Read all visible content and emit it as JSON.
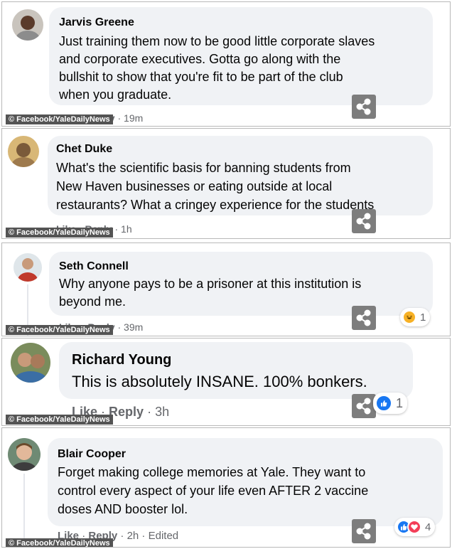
{
  "credit": "© Facebook/YaleDailyNews",
  "action_like": "Like",
  "action_reply": "Reply",
  "action_sep": "·",
  "colors": {
    "bubble": "#f0f2f5",
    "credit_bg": "#545454",
    "share_bg": "#7d7d7d",
    "like_blue": "#1877f2",
    "love_red": "#f33e58",
    "haha_yellow": "#f7b125",
    "muted_text": "#65676b"
  },
  "comments": [
    {
      "author": "Jarvis Greene",
      "lines": [
        "Just training them now to be good little corporate slaves",
        "and corporate executives. Gotta go along with the",
        "bullshit to show that you're fit to be part of the club",
        "when you graduate."
      ],
      "time": "19m"
    },
    {
      "author": "Chet Duke",
      "lines": [
        "What's the scientific basis for banning students from",
        "New Haven businesses or eating outside at local",
        "restaurants? What a cringey experience for the students"
      ],
      "time": "1h"
    },
    {
      "author": "Seth Connell",
      "lines": [
        "Why anyone pays to be a prisoner at this institution is",
        "beyond me."
      ],
      "time": "39m",
      "reactions": {
        "icons": [
          "haha-icon"
        ],
        "count": "1"
      }
    },
    {
      "author": "Richard Young",
      "lines": [
        "This is absolutely INSANE. 100% bonkers."
      ],
      "time": "3h",
      "reactions": {
        "icons": [
          "like-icon"
        ],
        "count": "1"
      }
    },
    {
      "author": "Blair Cooper",
      "lines": [
        "Forget making college memories at Yale. They want to",
        "control every aspect of your life even AFTER 2 vaccine",
        "doses AND booster lol."
      ],
      "time": "2h",
      "edited": "Edited",
      "reactions": {
        "icons": [
          "like-icon",
          "love-icon"
        ],
        "count": "4"
      }
    }
  ]
}
